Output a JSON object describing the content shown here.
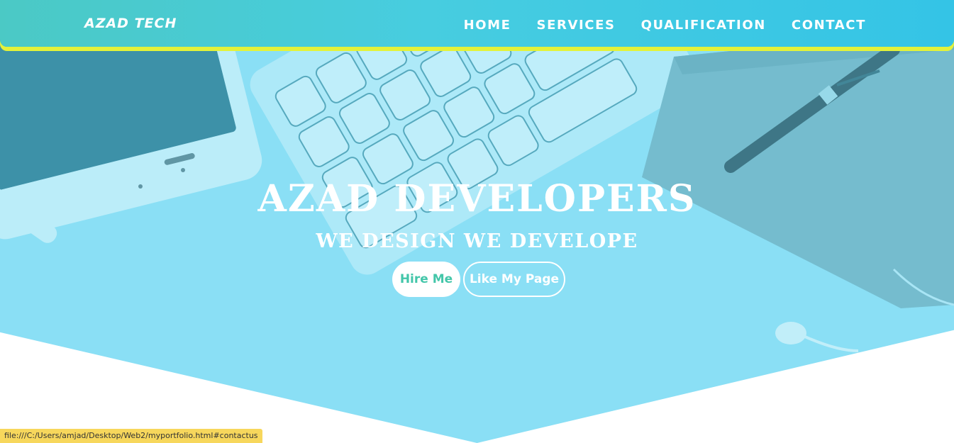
{
  "navbar": {
    "brand": "AZAD TECH",
    "links": [
      "HOME",
      "SERVICES",
      "QUALIFICATION",
      "CONTACT"
    ]
  },
  "hero": {
    "title": "AZAD DEVELOPERS",
    "subtitle": "WE DESIGN WE DEVELOPE",
    "hire_label": "Hire Me",
    "like_label": "Like My Page"
  },
  "status_bar": {
    "url": "file:///C:/Users/amjad/Desktop/Web2/myportfolio.html#contactus"
  },
  "colors": {
    "hero_overlay": "#8adff5",
    "navbar_start": "#4bc9c5",
    "navbar_end": "#34c4e6",
    "navbar_underline": "#e3f23a",
    "hire_text": "#43c6a9",
    "status_bar": "#f7d75c"
  },
  "icons": [
    "phone-image",
    "keyboard-image",
    "notebook-image",
    "pen-image",
    "earphone-image"
  ]
}
